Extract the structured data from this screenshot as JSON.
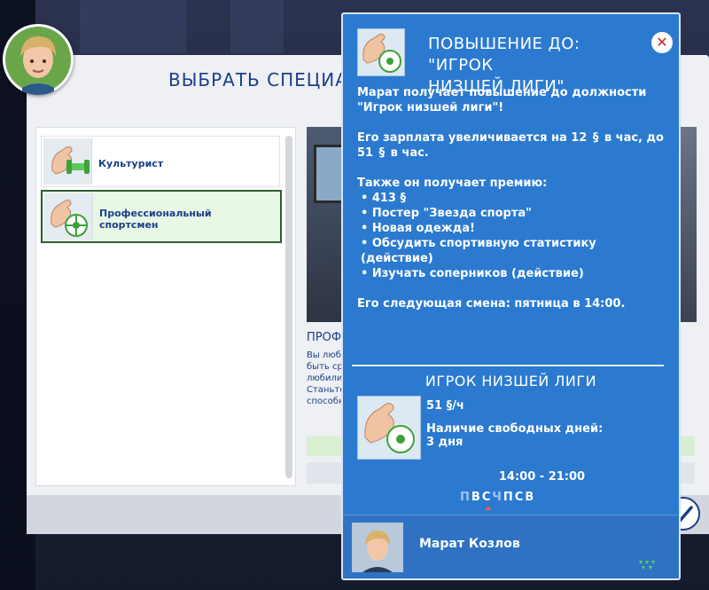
{
  "dialog": {
    "title": "ВЫБРАТЬ СПЕЦИАЛИЗА"
  },
  "list": {
    "items": [
      {
        "label": "Культурист",
        "selected": false
      },
      {
        "label": "Профессиональный спортсмен",
        "label_lines": [
          "Профессиональный",
          "спортсмен"
        ],
        "selected": true
      }
    ]
  },
  "preview": {
    "title": "ПРОФ",
    "desc_lines": [
      "Вы любі",
      "быть ср",
      "любили",
      "Станьте",
      "способн"
    ]
  },
  "popup": {
    "title_lines": [
      "ПОВЫШЕНИЕ ДО: \"ИГРОК",
      "НИЗШЕЙ ЛИГИ\""
    ],
    "close_label": "✕",
    "body": {
      "p1": "Марат получает повышение до должности \"Игрок низшей лиги\"!",
      "p2_pre": "Его зарплата увеличивается на 12",
      "p2_mid": "в час, до 51",
      "p2_post": "в час.",
      "bonus_header": "Также он получает премию:",
      "bonuses": [
        "• 413 §",
        "• Постер \"Звезда спорта\"",
        "• Новая одежда!",
        "• Обсудить спортивную статистику (действие)",
        "• Изучать соперников (действие)"
      ],
      "next_shift": "Его следующая смена: пятница в 14:00."
    },
    "level": {
      "title": "ИГРОК НИЗШЕЙ ЛИГИ",
      "salary": "51 §/ч",
      "days_off_label": "Наличие свободных дней:",
      "days_off_value": "3 дня",
      "hours": "14:00 - 21:00",
      "days": [
        {
          "d": "П",
          "work": false
        },
        {
          "d": "В",
          "work": true
        },
        {
          "d": "С",
          "work": true,
          "today": true
        },
        {
          "d": "Ч",
          "work": false
        },
        {
          "d": "П",
          "work": true
        },
        {
          "d": "С",
          "work": true
        },
        {
          "d": "В",
          "work": true
        }
      ]
    },
    "footer": {
      "sim_name": "Марат Козлов"
    }
  },
  "colors": {
    "popup_bg": "#2b7ad0",
    "title_blue": "#1c3e8a",
    "selected_green": "#2f5c32"
  }
}
